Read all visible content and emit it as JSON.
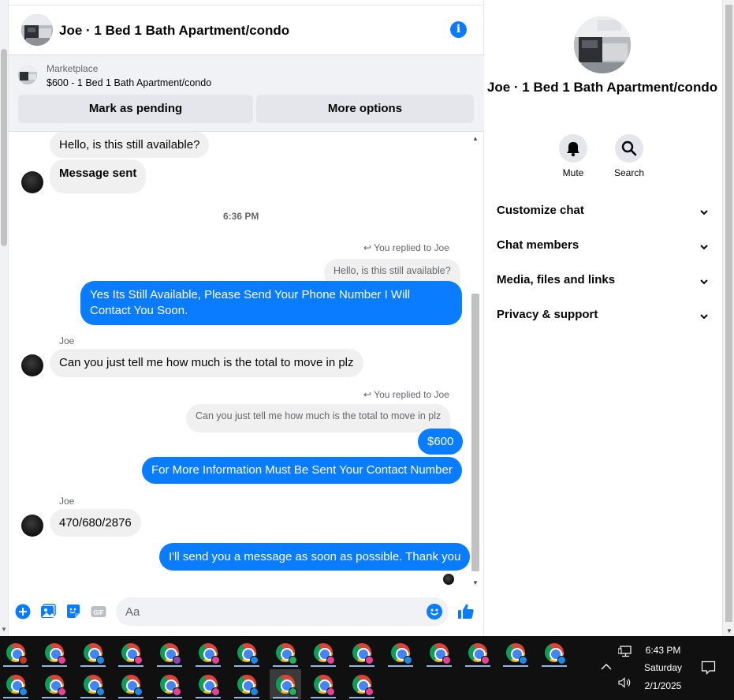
{
  "header": {
    "title": "Joe · 1 Bed 1 Bath Apartment/condo"
  },
  "marketplace": {
    "source": "Marketplace",
    "item": "$600 - 1 Bed 1 Bath Apartment/condo",
    "mark_pending_label": "Mark as pending",
    "more_options_label": "More options"
  },
  "messages": {
    "m1": "Hello, is this still available?",
    "m2": "Message sent",
    "timestamp": "6:36 PM",
    "reply1_label": "You replied to Joe",
    "reply1_quote": "Hello, is this still available?",
    "m3": "Yes Its Still Available, Please Send Your Phone Number I Will Contact You Soon.",
    "sender1": "Joe",
    "m4": "Can you just tell me how much is the total to move in plz",
    "reply2_label": "You replied to Joe",
    "reply2_quote": "Can you just tell me how much is the total to move in plz",
    "m5": "$600",
    "m6": "For More Information Must Be Sent Your Contact Number",
    "sender2": "Joe",
    "m7": "470/680/2876",
    "m8": "I'll send you a message as soon as possible. Thank you"
  },
  "composer": {
    "placeholder": "Aa"
  },
  "details": {
    "title": "Joe · 1 Bed 1 Bath Apartment/condo",
    "mute_label": "Mute",
    "search_label": "Search",
    "rows": [
      "Customize chat",
      "Chat members",
      "Media, files and links",
      "Privacy & support"
    ]
  },
  "taskbar": {
    "time": "6:43 PM",
    "day": "Saturday",
    "date": "2/1/2025",
    "app_icon": "chrome-icon",
    "profile_colors_row1": [
      "#c0392b",
      "#e84393",
      "#1e88e5",
      "#e84393",
      "#8e44ad",
      "#e84393",
      "#1e88e5",
      "#27ae60",
      "#e84393",
      "#e84393",
      "#1e88e5",
      "#e84393",
      "#e84393",
      "#1e88e5",
      "#1e88e5"
    ],
    "profile_colors_row2": [
      "#1e88e5",
      "#e84393",
      "#1e88e5",
      "#1e88e5",
      "#e84393",
      "#e84393",
      "#1e88e5",
      "#27ae60",
      "#e84393",
      "#e84393"
    ]
  },
  "colors": {
    "accent": "#0a7cff",
    "incoming_bubble": "#f0f0f0",
    "taskbar": "#101010"
  }
}
